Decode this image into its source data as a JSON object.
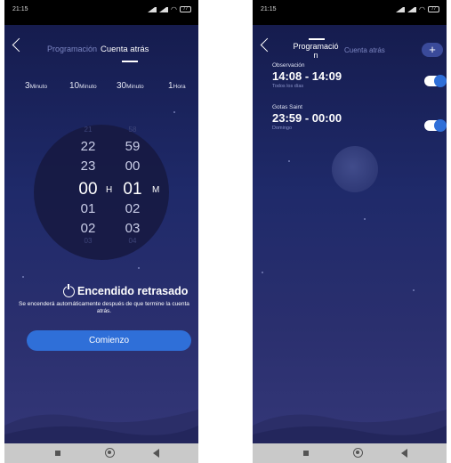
{
  "status_bar": {
    "time": "21:15",
    "battery": "77"
  },
  "left": {
    "tabs": {
      "inactive": "Programación",
      "active": "Cuenta atrás"
    },
    "quick_options": [
      {
        "number": "3",
        "unit": "Minuto"
      },
      {
        "number": "10",
        "unit": "Minuto"
      },
      {
        "number": "30",
        "unit": "Minuto"
      },
      {
        "number": "1",
        "unit": "Hora"
      }
    ],
    "hours": {
      "edge_top": "21",
      "far_top": "22",
      "near_top": "23",
      "selected": "00",
      "near_bottom": "01",
      "far_bottom": "02",
      "edge_bottom": "03"
    },
    "minutes": {
      "edge_top": "58",
      "far_top": "59",
      "near_top": "00",
      "selected": "01",
      "near_bottom": "02",
      "far_bottom": "03",
      "edge_bottom": "04"
    },
    "hour_unit": "H",
    "minute_unit": "M",
    "delay_title": "Encendido retrasado",
    "delay_description": "Se encenderá automáticamente después de que termine la cuenta atrás.",
    "start_button": "Comienzo"
  },
  "right": {
    "title_line1": "Programació",
    "title_line2": "n",
    "tab_inactive": "Cuenta atrás",
    "add_label": "+",
    "schedules": [
      {
        "name": "Observación",
        "range": "14:08 - 14:09",
        "days": "Todos los días",
        "enabled": true
      },
      {
        "name": "Gotas Saint",
        "range": "23:59 - 00:00",
        "days": "Domingo",
        "enabled": true
      }
    ]
  },
  "icons": [
    "back-icon",
    "power-icon",
    "signal-icon",
    "wifi-icon",
    "battery-icon",
    "nav-square-icon",
    "nav-home-icon",
    "nav-back-icon"
  ],
  "colors": {
    "accent": "#2f6fd8",
    "bg_top": "#141a4a",
    "bg_bottom": "#353879"
  }
}
